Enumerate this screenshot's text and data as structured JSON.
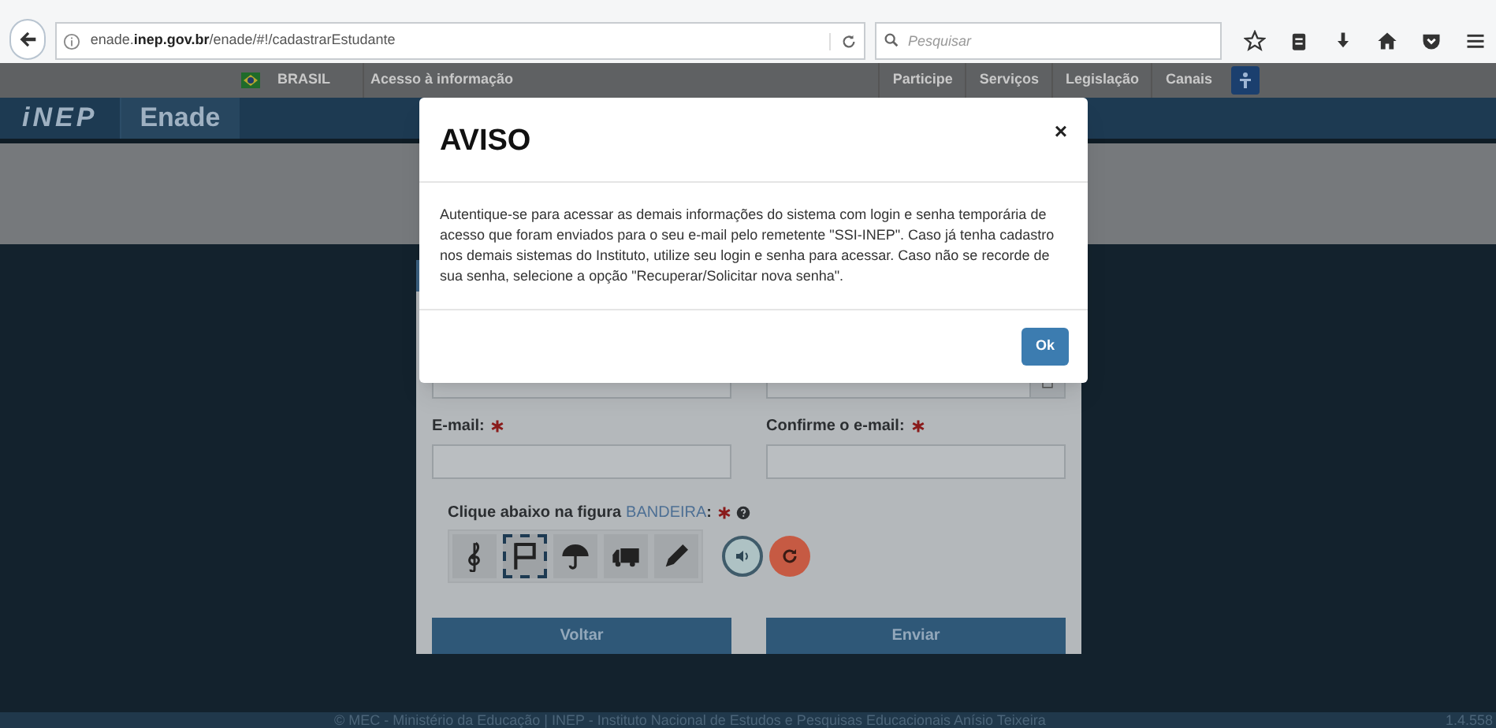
{
  "browser": {
    "url": "enade.**inep.gov.br**/enade/#!/cadastrarEstudante",
    "search_placeholder": "Pesquisar"
  },
  "gov_bar": {
    "brand": "BRASIL",
    "link": "Acesso à informação",
    "items": [
      "Participe",
      "Serviços",
      "Legislação",
      "Canais"
    ]
  },
  "header": {
    "logo": "iNEP",
    "title": "Enade"
  },
  "form": {
    "top_fields": [
      {
        "kind": "text"
      },
      {
        "kind": "date"
      }
    ],
    "fields": [
      {
        "label": "E-mail:",
        "required": true
      },
      {
        "label": "Confirme o e-mail:",
        "required": true
      }
    ],
    "captcha": {
      "prompt": "Clique abaixo na figura",
      "keyword": "BANDEIRA",
      "suffix": ":",
      "required": true,
      "images": [
        {
          "kind": "music",
          "selected": false
        },
        {
          "kind": "flag",
          "selected": true
        },
        {
          "kind": "umbrella",
          "selected": false
        },
        {
          "kind": "truck",
          "selected": false
        },
        {
          "kind": "pencil",
          "selected": false
        }
      ]
    },
    "buttons": [
      "Voltar",
      "Enviar"
    ]
  },
  "modal": {
    "title": "AVISO",
    "close": "×",
    "body": "Autentique-se para acessar as demais informações do sistema com login e senha temporária de acesso que foram enviados para o seu e-mail pelo remetente \"SSI-INEP\". Caso já tenha cadastro nos demais sistemas do Instituto, utilize seu login e senha para acessar. Caso não se recorde de sua senha, selecione a opção \"Recuperar/Solicitar nova senha\".",
    "button": "Ok"
  },
  "footer": {
    "text": "© MEC - Ministério da Educação | INEP - Instituto Nacional de Estudos e Pesquisas Educacionais Anísio Teixeira",
    "version": "1.4.558"
  }
}
